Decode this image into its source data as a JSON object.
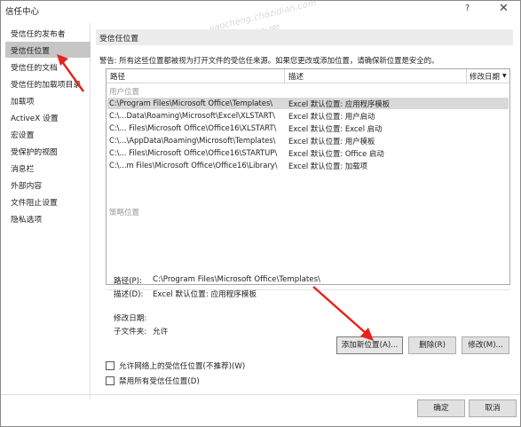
{
  "window": {
    "title": "信任中心",
    "help_glyph": "?",
    "close_glyph": "✕"
  },
  "watermark": {
    "url": "jiaocheng.chazidian.com",
    "text": "教程之家"
  },
  "sidebar": {
    "items": [
      {
        "label": "受信任的发布者",
        "active": false
      },
      {
        "label": "受信任位置",
        "active": true
      },
      {
        "label": "受信任的文档",
        "active": false
      },
      {
        "label": "受信任的加载项目录",
        "active": false
      },
      {
        "label": "加载项",
        "active": false
      },
      {
        "label": "ActiveX 设置",
        "active": false
      },
      {
        "label": "宏设置",
        "active": false
      },
      {
        "label": "受保护的视图",
        "active": false
      },
      {
        "label": "消息栏",
        "active": false
      },
      {
        "label": "外部内容",
        "active": false
      },
      {
        "label": "文件阻止设置",
        "active": false
      },
      {
        "label": "隐私选项",
        "active": false
      }
    ]
  },
  "main": {
    "section_title": "受信任位置",
    "warning": "警告: 所有这些位置都被视为打开文件的受信任来源。如果您更改或添加位置，请确保新位置是安全的。",
    "list": {
      "columns": [
        "路径",
        "描述",
        "修改日期"
      ],
      "sort_glyph": "▼",
      "user_group_label": "用户位置",
      "policy_group_label": "策略位置",
      "rows": [
        {
          "path": "C:\\Program Files\\Microsoft Office\\Templates\\",
          "desc": "Excel 默认位置: 应用程序模板",
          "selected": true
        },
        {
          "path": "C:\\...Data\\Roaming\\Microsoft\\Excel\\XLSTART\\",
          "desc": "Excel 默认位置: 用户启动",
          "selected": false
        },
        {
          "path": "C:\\... Files\\Microsoft Office\\Office16\\XLSTART\\",
          "desc": "Excel 默认位置: Excel 启动",
          "selected": false
        },
        {
          "path": "C:\\...\\AppData\\Roaming\\Microsoft\\Templates\\",
          "desc": "Excel 默认位置: 用户模板",
          "selected": false
        },
        {
          "path": "C:\\... Files\\Microsoft Office\\Office16\\STARTUP\\",
          "desc": "Excel 默认位置: Office 启动",
          "selected": false
        },
        {
          "path": "C:\\...m Files\\Microsoft Office\\Office16\\Library\\",
          "desc": "Excel 默认位置: 加载项",
          "selected": false
        }
      ]
    },
    "detail": {
      "path_label": "路径(P):",
      "path_value": "C:\\Program Files\\Microsoft Office\\Templates\\",
      "desc_label": "描述(D):",
      "desc_value": "Excel 默认位置: 应用程序模板",
      "modified_label": "修改日期:",
      "subfolders_label": "子文件夹:",
      "subfolders_value": "允许"
    },
    "buttons": {
      "add": "添加新位置(A)...",
      "remove": "删除(R)",
      "modify": "修改(M)..."
    },
    "checkboxes": {
      "allow_network": "允许网络上的受信任位置(不推荐)(W)",
      "disable_all": "禁用所有受信任位置(D)"
    }
  },
  "footer": {
    "ok": "确定",
    "cancel": "取消"
  },
  "colors": {
    "arrow": "#e8221b",
    "selected_sidebar": "#c6c6c6",
    "selected_row": "#d9d9d9"
  }
}
